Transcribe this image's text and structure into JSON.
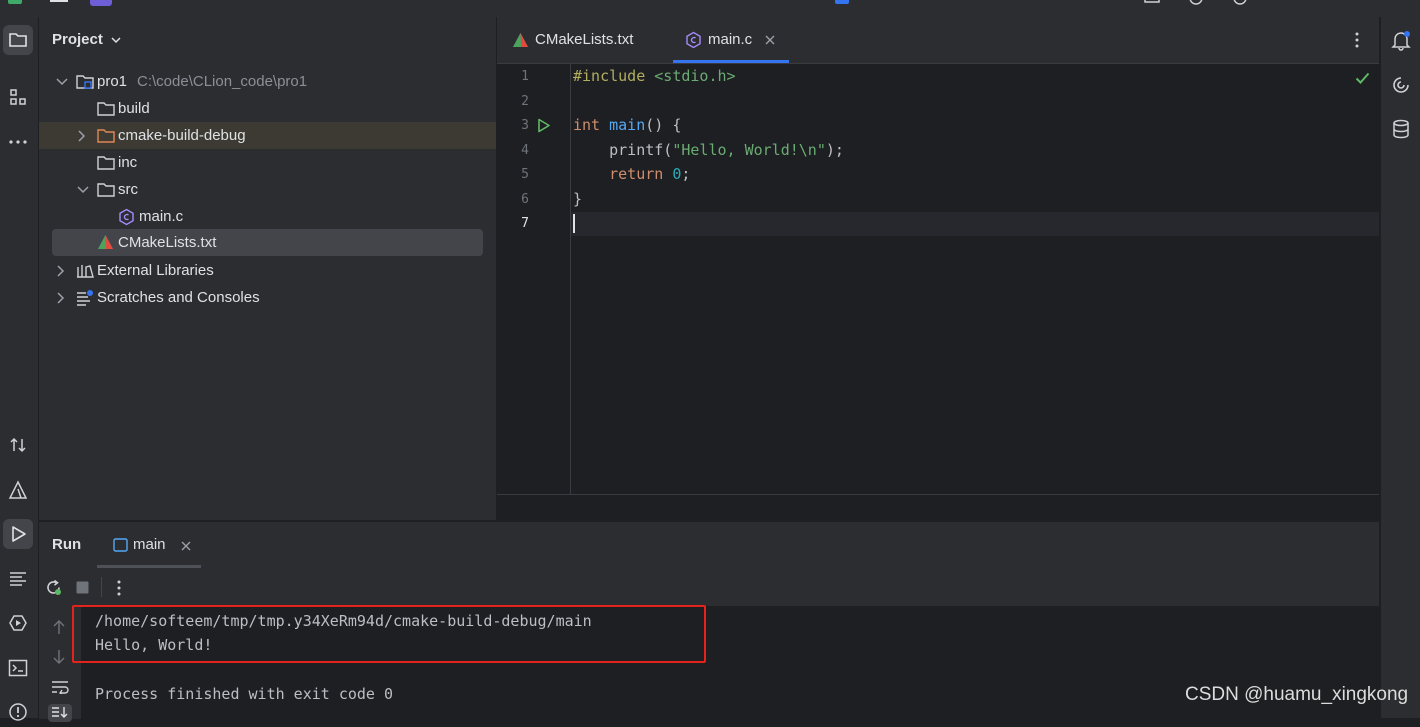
{
  "project_panel": {
    "title": "Project",
    "tree": [
      {
        "label": "pro1",
        "path": "C:\\code\\CLion_code\\pro1"
      },
      {
        "label": "build"
      },
      {
        "label": "cmake-build-debug"
      },
      {
        "label": "inc"
      },
      {
        "label": "src"
      },
      {
        "label": "main.c"
      },
      {
        "label": "CMakeLists.txt"
      },
      {
        "label": "External Libraries"
      },
      {
        "label": "Scratches and Consoles"
      }
    ]
  },
  "editor": {
    "tabs": [
      {
        "label": "CMakeLists.txt"
      },
      {
        "label": "main.c"
      }
    ],
    "line_numbers": [
      "1",
      "2",
      "3",
      "4",
      "5",
      "6",
      "7"
    ],
    "code": {
      "l1_directive": "#include",
      "l1_header": "<stdio.h>",
      "l3_type": "int",
      "l3_func": "main",
      "l3_rest": "() {",
      "l4_call": "printf(",
      "l4_string": "\"Hello, World!\\n\"",
      "l4_end": ");",
      "l5_kw": "return",
      "l5_num": "0",
      "l5_end": ";",
      "l6": "}"
    }
  },
  "run_panel": {
    "title": "Run",
    "tab_label": "main",
    "console_lines": [
      "/home/softeem/tmp/tmp.y34XeRm94d/cmake-build-debug/main",
      "Hello, World!",
      "Process finished with exit code 0"
    ]
  },
  "watermark": "CSDN @huamu_xingkong",
  "colors": {
    "accent": "#3574f0",
    "highlight_box": "#e5231b",
    "run_green": "#5fb865",
    "folder_orange": "#e08855"
  },
  "icons": {
    "left_stripe": [
      "folder-icon",
      "structure-icon",
      "more-icon",
      "commit-icon",
      "cmake-icon",
      "run-icon",
      "todo-icon",
      "services-icon",
      "terminal-icon",
      "problems-icon"
    ],
    "right_stripe": [
      "notifications-icon",
      "ai-assistant-icon",
      "database-icon"
    ]
  }
}
